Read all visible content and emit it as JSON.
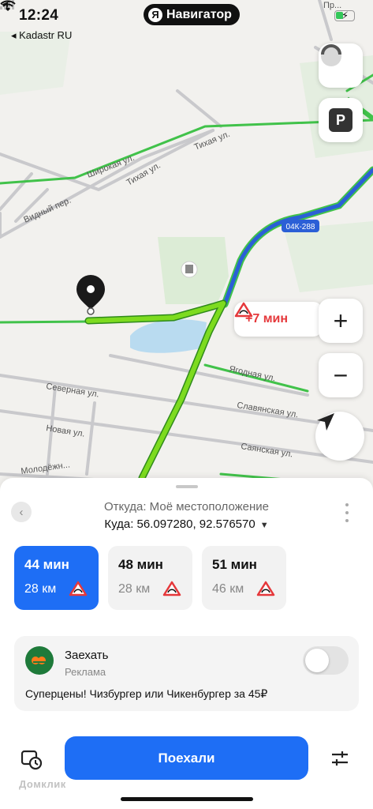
{
  "status_bar": {
    "time": "12:24",
    "app_badge": "Навигатор",
    "app_badge_letter": "Я",
    "back_app": "◂ Kadastr RU"
  },
  "map": {
    "streets": [
      "Широкая ул.",
      "Тихая ул.",
      "Тихая ул.",
      "Видный пер.",
      "Ягодная ул.",
      "Северная ул.",
      "Славянская ул.",
      "Новая ул.",
      "Саянская ул.",
      "Молодёжн...",
      "Пр..."
    ],
    "road_badge": "04К-288",
    "traffic_delay": "+7 мин",
    "colors": {
      "route": "#7ddb1f",
      "traffic_green": "#41c24a",
      "highway_blue": "#2b5fd6"
    }
  },
  "sheet": {
    "from": "Откуда: Моё местоположение",
    "to": "Куда: 56.097280, 92.576570",
    "routes": [
      {
        "time": "44 мин",
        "distance": "28 км",
        "selected": true
      },
      {
        "time": "48 мин",
        "distance": "28 км",
        "selected": false
      },
      {
        "time": "51 мин",
        "distance": "46 км",
        "selected": false
      }
    ],
    "ad": {
      "title": "Заехать",
      "label": "Реклама",
      "text": "Суперцены! Чизбургер или Чикенбургер за 45₽",
      "toggle_on": false
    },
    "go_button": "Поехали",
    "watermark": "Домклик"
  }
}
